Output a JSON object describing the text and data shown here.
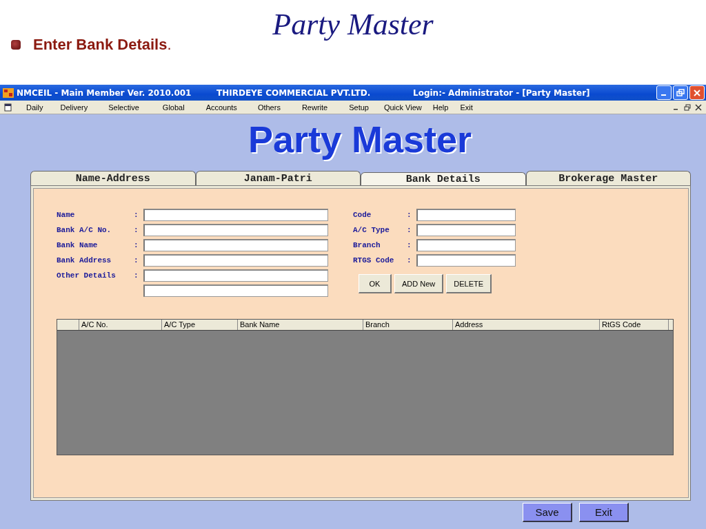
{
  "slide": {
    "title": "Party Master",
    "bullet": "**Enter Bank Details**."
  },
  "window": {
    "app_title": "NMCEIL - Main Member Ver. 2010.001",
    "company": "THIRDEYE COMMERCIAL PVT.LTD.",
    "login": "Login:-   Administrator - [Party Master]"
  },
  "menu": [
    "Daily",
    "Delivery",
    "Selective",
    "Global",
    "Accounts",
    "Others",
    "Rewrite",
    "Setup",
    "Quick View",
    "Help",
    "Exit"
  ],
  "form_title": "Party Master",
  "tabs": [
    {
      "label": "Name-Address",
      "selected": false
    },
    {
      "label": "Janam-Patri",
      "selected": false
    },
    {
      "label": "Bank Details",
      "selected": true
    },
    {
      "label": "Brokerage Master",
      "selected": false
    }
  ],
  "left_fields": [
    {
      "kind": "field",
      "label": "Name",
      "separator": ":"
    },
    {
      "kind": "field",
      "label": "Bank A/C No.",
      "separator": ":"
    },
    {
      "kind": "field",
      "label": "Bank Name",
      "separator": ":"
    },
    {
      "kind": "field",
      "label": "Bank Address",
      "separator": ":"
    },
    {
      "kind": "field",
      "label": "Other Details",
      "separator": ":"
    },
    {
      "kind": "extra-line"
    }
  ],
  "right_fields": [
    {
      "kind": "field",
      "label": "Code",
      "separator": ":"
    },
    {
      "kind": "field",
      "label": "A/C Type",
      "separator": ":"
    },
    {
      "kind": "field",
      "label": "Branch",
      "separator": ":"
    },
    {
      "kind": "field",
      "label": "RTGS Code",
      "separator": ":"
    }
  ],
  "form_buttons": [
    "OK",
    "ADD New",
    "DELETE"
  ],
  "table": {
    "columns": [
      "A/C No.",
      "A/C Type",
      "Bank Name",
      "Branch",
      "Address",
      "RtGS Code"
    ]
  },
  "buttons": [
    "Save",
    "Exit"
  ]
}
